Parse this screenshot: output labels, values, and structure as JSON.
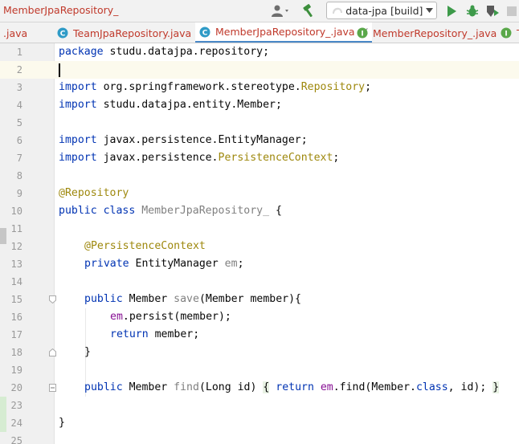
{
  "window": {
    "breadcrumb": "MemberJpaRepository_"
  },
  "toolbar": {
    "run_config": "data-jpa [build]",
    "icons": [
      "user-icon",
      "hammer-icon",
      "run-icon",
      "debug-icon",
      "coverage-icon",
      "stop-icon"
    ]
  },
  "tabs": [
    {
      "label": ".java",
      "icon": "none"
    },
    {
      "label": "TeamJpaRepository.java",
      "icon": "class-icon",
      "close": "×"
    },
    {
      "label": "MemberJpaRepository_.java",
      "icon": "class-icon",
      "close": "×",
      "active": true
    },
    {
      "label": "MemberRepository_.java",
      "icon": "interface-icon",
      "close": "×"
    },
    {
      "label": "T",
      "icon": "interface-icon"
    }
  ],
  "editor": {
    "current_line": 2,
    "line_numbers": [
      "1",
      "2",
      "3",
      "4",
      "5",
      "6",
      "7",
      "8",
      "9",
      "10",
      "11",
      "12",
      "13",
      "14",
      "15",
      "16",
      "17",
      "18",
      "19",
      "20",
      "23",
      "24",
      "25"
    ],
    "code": {
      "l1": [
        "package",
        " studu.datajpa.repository;"
      ],
      "l3": [
        "import",
        " org.springframework.stereotype.",
        "Repository",
        ";"
      ],
      "l4": [
        "import",
        " studu.datajpa.entity.Member;"
      ],
      "l6": [
        "import",
        " javax.persistence.EntityManager;"
      ],
      "l7": [
        "import",
        " javax.persistence.",
        "PersistenceContext",
        ";"
      ],
      "l9": [
        "@Repository"
      ],
      "l10": [
        "public class",
        " ",
        "MemberJpaRepository_",
        " {"
      ],
      "l12": [
        "@PersistenceContext"
      ],
      "l13": [
        "private",
        " EntityManager ",
        "em",
        ";"
      ],
      "l15": [
        "public",
        " Member ",
        "save",
        "(Member member){"
      ],
      "l16": [
        "em",
        ".persist(member);"
      ],
      "l17": [
        "return",
        " member;"
      ],
      "l18": [
        "}"
      ],
      "l20": [
        "public",
        " Member ",
        "find",
        "(Long id) ",
        "{",
        " ",
        "return",
        " ",
        "em",
        ".find(Member.",
        "class",
        ", id); ",
        "}"
      ],
      "l24": [
        "}"
      ]
    }
  },
  "colors": {
    "keyword": "#0033b3",
    "annotation": "#9e880d",
    "field": "#871094",
    "unused": "#808080",
    "tab_accent": "#4a88c7",
    "error_text": "#c0392b"
  }
}
